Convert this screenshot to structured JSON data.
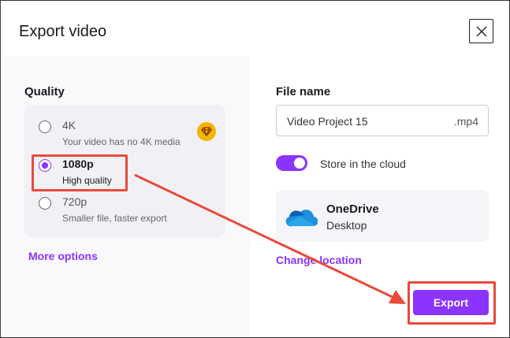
{
  "dialog": {
    "title": "Export video",
    "close_icon": "close-icon"
  },
  "quality": {
    "heading": "Quality",
    "options": [
      {
        "label": "4K",
        "sub": "Your video has no 4K media",
        "selected": false,
        "premium_icon": "gem-icon"
      },
      {
        "label": "1080p",
        "sub": "High quality",
        "selected": true
      },
      {
        "label": "720p",
        "sub": "Smaller file, faster export",
        "selected": false
      }
    ],
    "more_options": "More options"
  },
  "file": {
    "heading": "File name",
    "value": "Video Project 15",
    "extension": ".mp4"
  },
  "cloud": {
    "label": "Store in the cloud",
    "enabled": true
  },
  "location": {
    "service": "OneDrive",
    "folder": "Desktop",
    "change": "Change location"
  },
  "actions": {
    "export": "Export"
  },
  "colors": {
    "accent": "#8b33ff",
    "annotation": "#e84a3c"
  }
}
